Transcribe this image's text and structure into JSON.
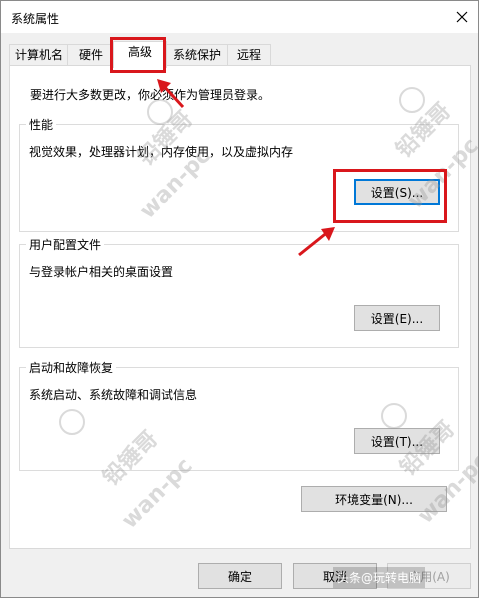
{
  "window": {
    "title": "系统属性"
  },
  "tabs": [
    {
      "label": "计算机名"
    },
    {
      "label": "硬件"
    },
    {
      "label": "高级"
    },
    {
      "label": "系统保护"
    },
    {
      "label": "远程"
    }
  ],
  "panel": {
    "notice": "要进行大多数更改，你必须作为管理员登录。",
    "performance": {
      "title": "性能",
      "description": "视觉效果，处理器计划，内存使用，以及虚拟内存",
      "button": "设置(S)..."
    },
    "user_profiles": {
      "title": "用户配置文件",
      "description": "与登录帐户相关的桌面设置",
      "button": "设置(E)..."
    },
    "startup_recovery": {
      "title": "启动和故障恢复",
      "description": "系统启动、系统故障和调试信息",
      "button": "设置(T)..."
    },
    "env_button": "环境变量(N)..."
  },
  "footer": {
    "ok": "确定",
    "cancel": "取消",
    "apply": "应用(A)"
  },
  "watermark": {
    "text1": "铅锤哥",
    "text2": "wan-pc"
  },
  "caption": "头条@玩转电脑",
  "colors": {
    "highlight": "#d9171c",
    "focus": "#0078d7"
  }
}
